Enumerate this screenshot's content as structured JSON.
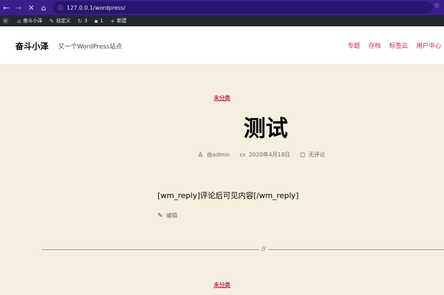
{
  "browser": {
    "url": "127.0.0.1/wordpress/"
  },
  "admin_bar": {
    "site_name": "奋斗小泽",
    "customize": "自定义",
    "updates": "3",
    "comments": "1",
    "new": "新建"
  },
  "header": {
    "title": "奋斗小泽",
    "description": "又一个WordPress站点",
    "menu": [
      "专题",
      "存档",
      "标签云",
      "用户中心"
    ]
  },
  "post": {
    "category": "未分类",
    "title": "测试",
    "author": "由admin",
    "date": "2020年4月18日",
    "comments": "无评论",
    "body": "[wm_reply]评论后可见内容[/wm_reply]",
    "edit": "编辑"
  },
  "separator": "//",
  "next_post": {
    "category": "未分类"
  },
  "colors": {
    "accent": "#cd2653",
    "background": "#f5efe0",
    "browser_bar": "#3a1f8a",
    "admin_bar": "#23282d"
  }
}
